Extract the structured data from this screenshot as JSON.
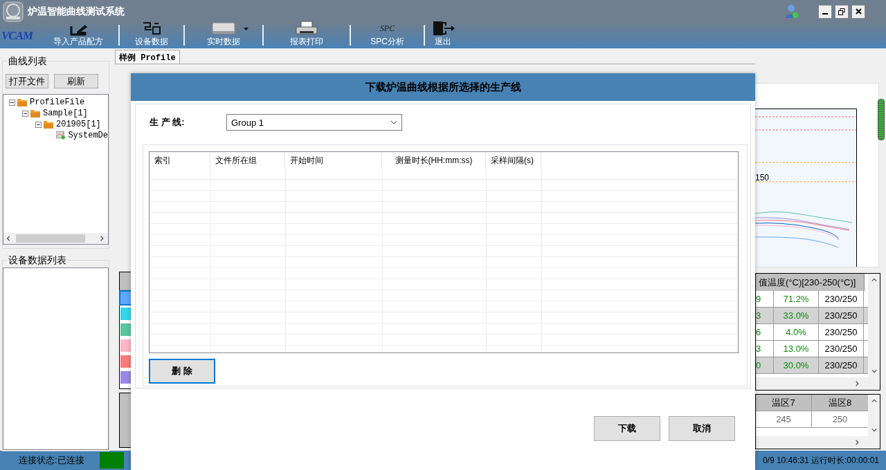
{
  "window": {
    "title": "炉温智能曲线测试系统"
  },
  "toolbar": {
    "brand": "VCAM",
    "items": [
      {
        "label": "导入产品配方",
        "kind": "import",
        "dropdown": false
      },
      {
        "label": "设备数据",
        "kind": "device",
        "dropdown": false
      },
      {
        "label": "实时数据",
        "kind": "realtime",
        "dropdown": true
      },
      {
        "label": "报表打印",
        "kind": "print",
        "dropdown": false
      },
      {
        "label": "SPC分析",
        "kind": "spc",
        "icon_text": "SPC",
        "dropdown": false
      },
      {
        "label": "退出",
        "kind": "exit",
        "dropdown": false
      }
    ]
  },
  "curve_list": {
    "title": "曲线列表",
    "buttons": [
      "打开文件",
      "刷新"
    ],
    "tree": [
      {
        "label": "ProfileFile",
        "kind": "folder",
        "expanded": true,
        "children": [
          {
            "label": "Sample[1]",
            "kind": "folder",
            "expanded": true,
            "children": [
              {
                "label": "201905[1]",
                "kind": "folder",
                "expanded": true,
                "children": [
                  {
                    "label": "SystemDe",
                    "kind": "file"
                  }
                ]
              }
            ]
          }
        ]
      }
    ]
  },
  "device_list": {
    "title": "设备数据列表"
  },
  "tabs": [
    {
      "label": "样例 Profile",
      "selected": true
    }
  ],
  "swatches": [
    {
      "color": "#60a8ff",
      "selected": true
    },
    {
      "color": "#33d6ea",
      "selected": false
    },
    {
      "color": "#5cc6a0",
      "selected": false
    },
    {
      "color": "#ffb6c8",
      "selected": false
    },
    {
      "color": "#ff7b7b",
      "selected": false
    },
    {
      "color": "#9a88e8",
      "selected": false
    }
  ],
  "chart_fragment": {
    "tick_label": "150"
  },
  "summary_table": {
    "header": "值温度(°C)[230-250(°C)]",
    "rows": [
      {
        "cells": [
          "9",
          "71.2%",
          "230/250"
        ],
        "highlighted": false
      },
      {
        "cells": [
          "3",
          "33.0%",
          "230/250"
        ],
        "highlighted": true
      },
      {
        "cells": [
          "6",
          "4.0%",
          "230/250"
        ],
        "highlighted": false
      },
      {
        "cells": [
          "3",
          "13.0%",
          "230/250"
        ],
        "highlighted": false
      },
      {
        "cells": [
          "0",
          "30.0%",
          "230/250"
        ],
        "highlighted": true
      }
    ]
  },
  "zone_table": {
    "columns": [
      "温区7",
      "温区8"
    ],
    "rows": [
      [
        "245",
        "250"
      ]
    ]
  },
  "status_bar": {
    "connection": "连接状态:已连接",
    "connected": true,
    "clock": "0/9 10:46:31 运行时长:00:00:01"
  },
  "dialog": {
    "title": "下载炉温曲线根据所选择的生产线",
    "line_label": "生 产 线:",
    "line_value": "Group 1",
    "columns": [
      "索引",
      "文件所在组",
      "开始时间",
      "测量时长(HH:mm:ss)",
      "采样间隔(s)"
    ],
    "delete_button": "删 除",
    "buttons": [
      "下载",
      "取消"
    ]
  }
}
